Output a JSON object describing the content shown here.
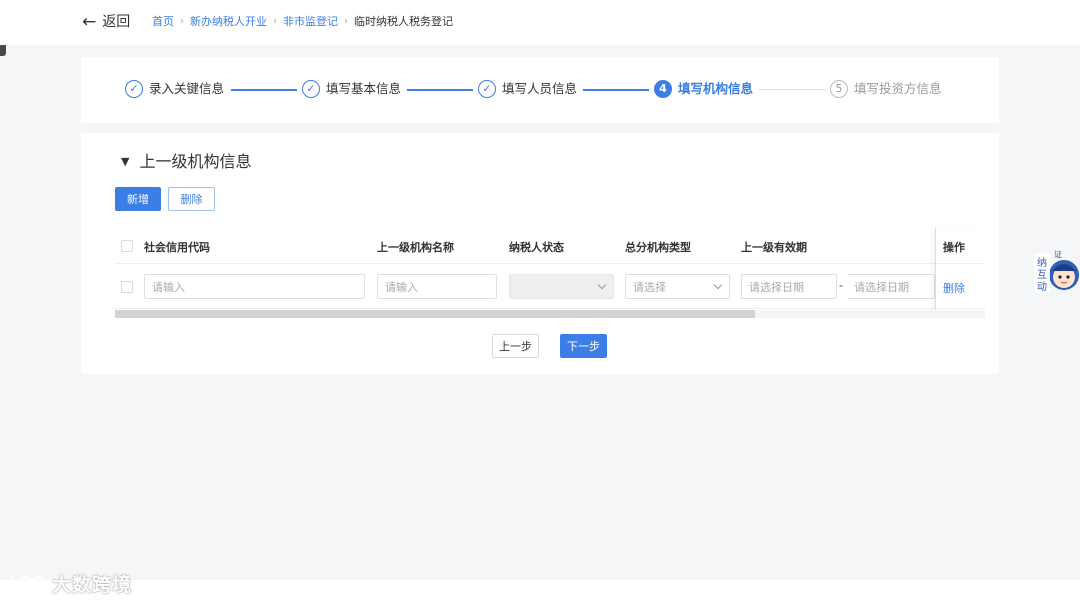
{
  "header": {
    "back_label": "返回",
    "breadcrumbs": [
      "首页",
      "新办纳税人开业",
      "非市监登记"
    ],
    "current": "临时纳税人税务登记"
  },
  "steps": [
    {
      "num": "✓",
      "label": "录入关键信息",
      "state": "done"
    },
    {
      "num": "✓",
      "label": "填写基本信息",
      "state": "done"
    },
    {
      "num": "✓",
      "label": "填写人员信息",
      "state": "done"
    },
    {
      "num": "4",
      "label": "填写机构信息",
      "state": "active"
    },
    {
      "num": "5",
      "label": "填写投资方信息",
      "state": "todo"
    }
  ],
  "section": {
    "title": "上一级机构信息",
    "add_label": "新增",
    "delete_label": "删除"
  },
  "table": {
    "headers": [
      "社会信用代码",
      "上一级机构名称",
      "纳税人状态",
      "总分机构类型",
      "上一级有效期",
      "操作"
    ],
    "row": {
      "credit_placeholder": "请输入",
      "name_placeholder": "请输入",
      "status_value": "",
      "type_placeholder": "请选择",
      "date_start_placeholder": "请选择日期",
      "date_sep": "-",
      "date_end_placeholder": "请选择日期",
      "op_delete": "删除"
    }
  },
  "nav": {
    "prev_label": "上一步",
    "next_label": "下一步"
  },
  "mascot": {
    "text": "纳互动",
    "badge": "证"
  },
  "watermark": {
    "text": "大数跨境"
  },
  "colors": {
    "primary": "#3a7ee6",
    "background": "#f5f6f8"
  }
}
